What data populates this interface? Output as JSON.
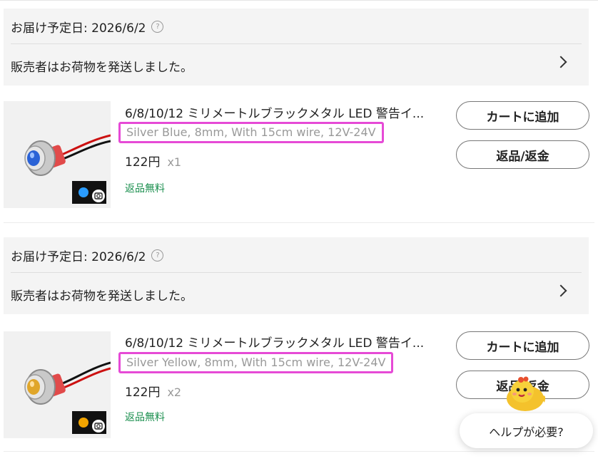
{
  "orders": [
    {
      "delivery": "お届け予定日: 2026/6/2",
      "help_mark": "?",
      "shipped": "販売者はお荷物を発送しました。",
      "title": "6/8/10/12 ミリメートルブラックメタル LED 警告イ...",
      "variant": "Silver Blue, 8mm, With 15cm wire, 12V-24V",
      "price": "122円",
      "qty": "x1",
      "free_return": "返品無料",
      "cart_button": "カートに追加",
      "return_button": "返品/返金",
      "led_color": "#2a62d6"
    },
    {
      "delivery": "お届け予定日: 2026/6/2",
      "help_mark": "?",
      "shipped": "販売者はお荷物を発送しました。",
      "title": "6/8/10/12 ミリメートルブラックメタル LED 警告イ...",
      "variant": "Silver Yellow, 8mm, With 15cm wire, 12V-24V",
      "price": "122円",
      "qty": "x2",
      "free_return": "返品無料",
      "cart_button": "カートに追加",
      "return_button": "返品/返金",
      "led_color": "#e0a62a"
    }
  ],
  "help_button": "ヘルプが必要?",
  "colors": {
    "highlight": "#e64ad6",
    "free_return": "#1a8f4e",
    "header_bg": "#f4f4f4"
  }
}
